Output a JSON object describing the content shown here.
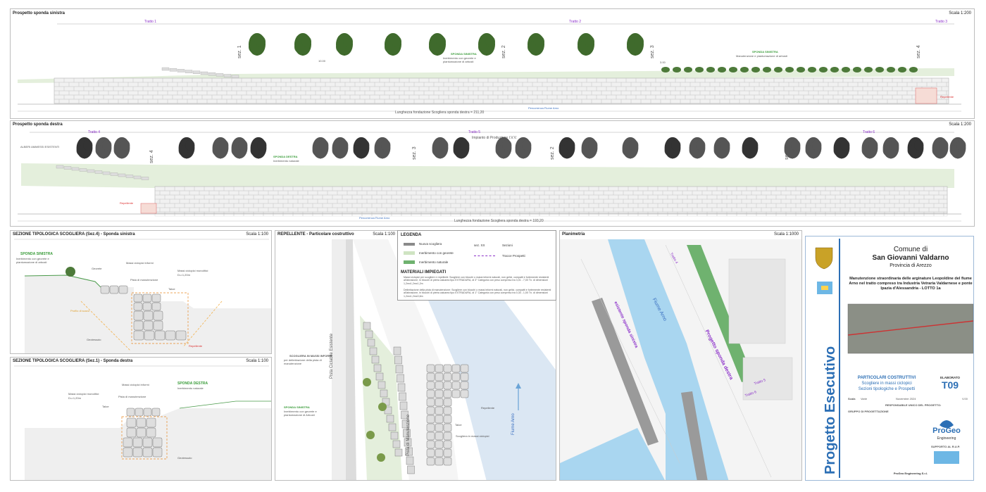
{
  "top_panel": {
    "title": "Prospetto sponda sinistra",
    "scale": "Scala 1:200",
    "tratti": [
      "Tratto 1",
      "Tratto 2",
      "Tratto 3"
    ],
    "sections": [
      "sez. 1",
      "sez. 2",
      "sez. 3",
      "sez. 4"
    ],
    "labels": {
      "sponda_sinistra_1": "SPONDA SINISTRA",
      "sponda_sinistra_1_desc": "Inerbimento con georete e piantumazione di arbusti",
      "sponda_sinistra_2": "SPONDA SINISTRA",
      "sponda_sinistra_2_desc": "Manutenzione e piantumazione di arbusti",
      "dim_1": "10.00",
      "dim_2": "3.00",
      "percorrenza": "Percorrenza Fiume Arno",
      "repellente": "Repellente",
      "lunghezza": "Lunghezza fondazione Scogliera sponda destra = 211,20"
    }
  },
  "mid_panel": {
    "title": "Prospetto sponda destra",
    "scale": "Scala 1:200",
    "tratti": [
      "Tratto 4",
      "Tratto 5",
      "Tratto 6"
    ],
    "sections": [
      "sez. 4",
      "sez. 3",
      "sez. 2",
      "sez. 1"
    ],
    "labels": {
      "impianto": "Impianto di Produzione I.V.V.",
      "sponda_destra": "SPONDA DESTRA",
      "sponda_destra_desc": "Inerbimento naturale",
      "albero_note": "ALBERI AMMESSI ESISTENTI",
      "repellente": "Repellente",
      "percorrenza": "Percorrenza Fiume Arno",
      "lunghezza": "Lunghezza fondazione Scogliera sponda destra = 193,20"
    }
  },
  "sez4_panel": {
    "title": "SEZIONE TIPOLOGICA SCOGLIERA (Sez.4) - Sponda sinistra",
    "scale": "Scala 1:100",
    "labels": {
      "sponda": "SPONDA SINISTRA",
      "sponda_desc": "Inerbimento con georete e piantumazione di arbusti",
      "georete": "Georete",
      "massi_informi": "Massi ciclopici informi",
      "massi_monolitici": "Massi ciclopici monolitici",
      "dn": "Dₙ=1,20m",
      "pista": "Pista di manutenzione",
      "taloe": "Taloe",
      "profilo": "Profilo di scavo",
      "geotessuto": "Geotessuto",
      "repellente": "Repellente"
    }
  },
  "sez1_panel": {
    "title": "SEZIONE TIPOLOGICA SCOGLIERA (Sez.1) - Sponda destra",
    "scale": "Scala 1:100",
    "labels": {
      "massi_informi": "Massi ciclopici informi",
      "sponda": "SPONDA DESTRA",
      "sponda_desc": "Inerbimento naturale",
      "massi_monolitici": "Massi ciclopici monolitici",
      "dn": "Dₙ=1,20m",
      "pista": "Pista di manutenzione",
      "taloe": "Taloe",
      "geotessuto": "Geotessuto"
    }
  },
  "repellente_panel": {
    "title": "REPELLENTE - Particolare costruttivo",
    "scale": "Scala 1:100",
    "labels": {
      "pista_ciclabile": "Pista Ciclabile Esistente",
      "scogliera": "SCOGLIERA IN MASSI INFORMI",
      "scogliera_desc": "per delimitazione della pista di manutenzione",
      "sponda": "SPONDA SINISTRA",
      "sponda_desc": "Inerbimento con georete e piantumazione di Arbusti",
      "pista_manutenzione": "Pista di Manutenzione",
      "repellente": "Repellente",
      "taloe": "Taloe",
      "scogliera_massi": "Scogliera in massi ciclopici",
      "fiume": "Fiume Arno"
    }
  },
  "legend": {
    "title": "LEGENDA",
    "items": [
      "Nuova scogliera",
      "Inerbimento con georete",
      "Inerbimento naturale"
    ],
    "items_right": [
      "Sezioni",
      "Tracce Prospetti"
    ],
    "sez_label": "sez. XX",
    "materiali_title": "MATERIALI IMPIEGATI",
    "materiali": [
      "Massi ciclopici per scogliere e repellenti: Scogliere con blocchi o massi informi naturali, non gelivi, compatti e fortemente resistenti all'abrasione, in blocchi di pietra calcarea tipo EXTRADURA, di 3° Categoria con peso compreso tra 3,01 - 7,00 Tn. di dimensioni 1,2mx1,2mx1,2m",
      "Delimitazione della pista di manutenzione: Scogliere con blocchi o massi informi naturali, non gelivi, compatti e fortemente resistenti all'abrasione, in blocchi di pietra calcarea tipo EXTRADURA, di 1° Categoria con peso compreso tra 0,30 - 1,00 Tn. di dimensioni 1,2mx1,2mx0,6m"
    ]
  },
  "planimetria": {
    "title": "Planimetria",
    "scale": "Scala 1:1000",
    "labels": {
      "fiume": "Fiume Arno",
      "esistente": "esistente sponda sinistra",
      "progetto": "Progetto sponda destra",
      "tratto4": "Tratto 4",
      "tratto5": "Tratto 5",
      "tratto6": "Tratto 6",
      "tratto1": "Tratto 1",
      "tratto2": "Tratto 2",
      "tratto3": "Tratto 3"
    }
  },
  "title_block": {
    "vertical": "Progetto Esecutivo",
    "comune": "Comune di",
    "comune_name": "San Giovanni Valdarno",
    "provincia": "Provincia di Arezzo",
    "description": "Manutenzione straordinaria delle arginature Leopoldine del fiume Arno nel tratto compreso tra Industria Vetraria Valdarnese e ponte Ipazia d'Alessandria - LOTTO 1a",
    "section": "PARTICOLARI COSTRUTTIVI",
    "section_sub1": "Scogliere in massi ciclopici",
    "section_sub2": "Sezioni tipologiche e Prospetti",
    "elaborato_label": "ELABORATO",
    "elaborato": "T09",
    "scala_label": "Scala",
    "scala_val": "Varie",
    "data": "Novembre 2024",
    "version": "V.00",
    "responsabile": "RESPONSABILE UNICO DEL PROGETTO:",
    "gruppo": "GRUPPO DI PROGETTAZIONE",
    "supporto": "SUPPORTO AL R.U.P.",
    "progeo": "ProGeo",
    "progeo_sub": "Engineering",
    "footer": "ProGeo Engineering S.r.l."
  }
}
